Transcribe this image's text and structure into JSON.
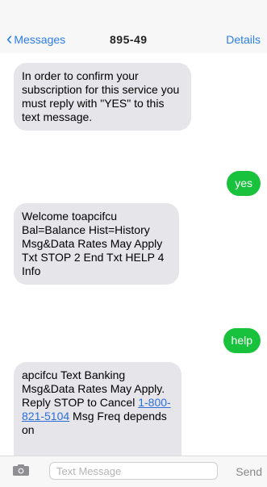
{
  "nav": {
    "back_label": "Messages",
    "title": "895-49",
    "details_label": "Details",
    "back_icon": "chevron-left-icon"
  },
  "messages": [
    {
      "direction": "incoming",
      "text": "In order to confirm your subscription for this service you must reply with \"YES\" to this text message."
    },
    {
      "direction": "outgoing",
      "text": "yes"
    },
    {
      "direction": "incoming",
      "text": "Welcome toapcifcu Bal=Balance Hist=History Msg&Data Rates May Apply Txt STOP 2 End Txt HELP 4 Info"
    },
    {
      "direction": "outgoing",
      "text": "help"
    },
    {
      "direction": "incoming",
      "text_before_link": "apcifcu Text Banking Msg&Data Rates May Apply. Reply STOP to Cancel ",
      "link": "1-800-821-5104",
      "text_after_link": " Msg Freq depends on"
    }
  ],
  "composer": {
    "placeholder": "Text Message",
    "send_label": "Send",
    "camera_icon": "camera-icon"
  },
  "colors": {
    "accent": "#2b7de9",
    "outgoing_bubble": "#18c23d",
    "incoming_bubble": "#e5e5ea"
  }
}
